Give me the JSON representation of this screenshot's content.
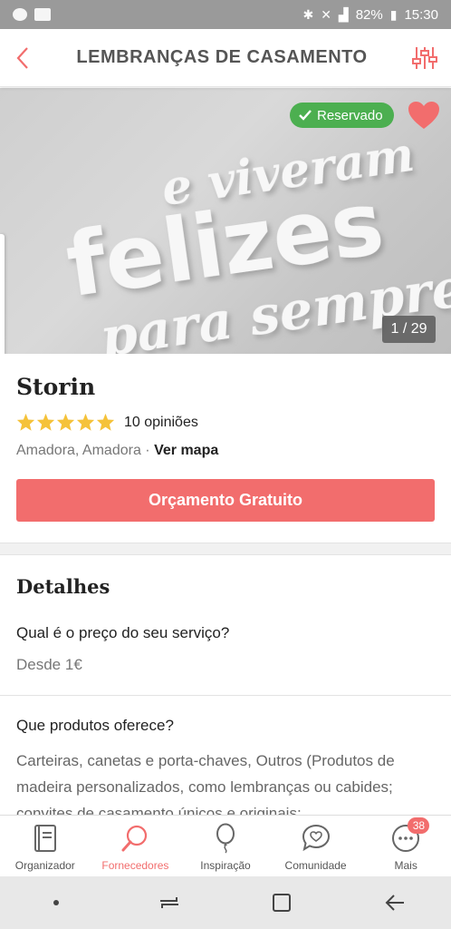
{
  "status_bar": {
    "battery": "82%",
    "time": "15:30"
  },
  "header": {
    "title": "LEMBRANÇAS DE CASAMENTO"
  },
  "gallery": {
    "reserved_label": "Reservado",
    "counter": "1 / 29",
    "image_text": [
      "e viveram",
      "felizes",
      "para sempre"
    ]
  },
  "vendor": {
    "name": "Storin",
    "rating": 5,
    "reviews": "10 opiniões",
    "location": "Amadora, Amadora",
    "separator": " · ",
    "map_link": "Ver mapa",
    "cta": "Orçamento Gratuito"
  },
  "details": {
    "title": "Detalhes",
    "items": [
      {
        "question": "Qual é o preço do seu serviço?",
        "answer": "Desde 1€"
      },
      {
        "question": "Que produtos oferece?",
        "answer": "Carteiras, canetas e porta-chaves, Outros (Produtos de madeira personalizados, como lembranças ou cabides; convites de casamento únicos e originais;"
      }
    ]
  },
  "bottom_nav": {
    "items": [
      {
        "label": "Organizador",
        "icon": "notebook-icon"
      },
      {
        "label": "Fornecedores",
        "icon": "search-icon"
      },
      {
        "label": "Inspiração",
        "icon": "balloon-icon"
      },
      {
        "label": "Comunidade",
        "icon": "chat-heart-icon"
      },
      {
        "label": "Mais",
        "icon": "more-icon",
        "badge": "38"
      }
    ]
  },
  "colors": {
    "accent": "#f26d6d",
    "reserved": "#4caf50",
    "status_bar": "#9a9a9a"
  }
}
